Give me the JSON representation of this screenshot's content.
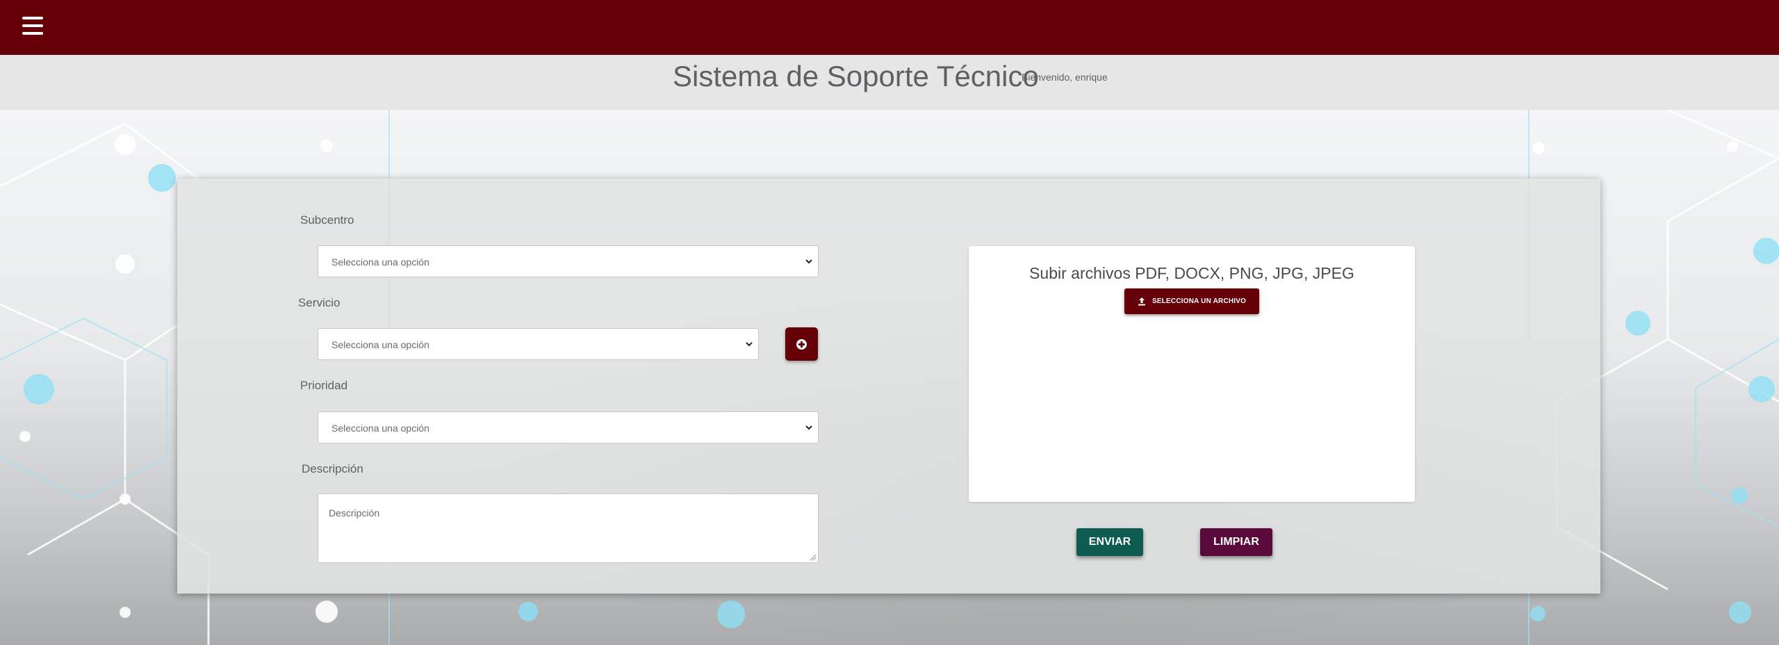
{
  "header": {
    "menu_icon": "hamburger-menu-icon",
    "title": "Sistema de Soporte Técnico",
    "welcome": "Bienvenido, enrique"
  },
  "form": {
    "subcentro": {
      "label": "Subcentro",
      "selected": "Selecciona una opción"
    },
    "servicio": {
      "label": "Servicio",
      "selected": "Selecciona una opción",
      "add_icon": "plus-circle-icon"
    },
    "prioridad": {
      "label": "Prioridad",
      "selected": "Selecciona una opción"
    },
    "descripcion": {
      "label": "Descripción",
      "placeholder": "Descripción"
    }
  },
  "upload": {
    "title": "Subir archivos PDF, DOCX, PNG, JPG, JPEG",
    "button_label": "SELECCIONA UN ARCHIVO",
    "button_icon": "upload-icon"
  },
  "actions": {
    "send_label": "ENVIAR",
    "clear_label": "LIMPIAR"
  },
  "colors": {
    "brand": "#650008",
    "send": "#0e5c51",
    "clear": "#5a0a3a"
  }
}
